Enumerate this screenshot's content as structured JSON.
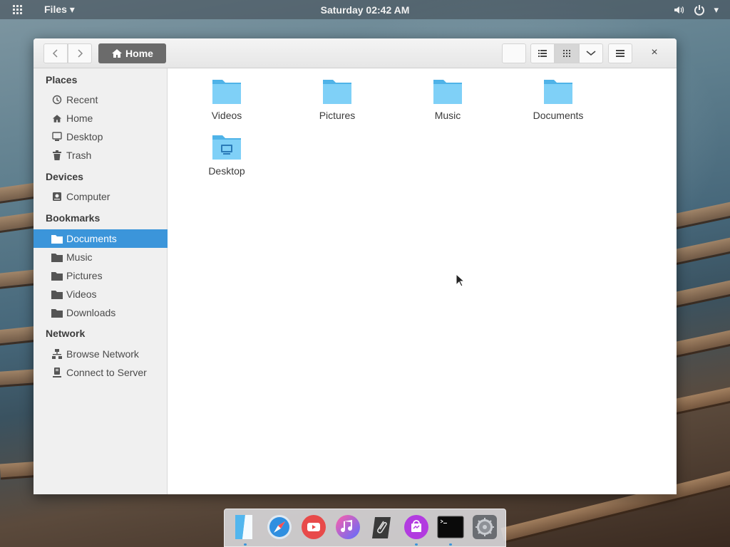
{
  "topbar": {
    "app_menu": "Files ▾",
    "clock": "Saturday 02:42 AM",
    "dropdown_arrow": "▾"
  },
  "window": {
    "path_label": "Home",
    "close_glyph": "×",
    "view_mode": "grid"
  },
  "sidebar": {
    "sections": [
      {
        "title": "Places",
        "items": [
          {
            "label": "Recent",
            "icon": "clock-icon"
          },
          {
            "label": "Home",
            "icon": "home-icon"
          },
          {
            "label": "Desktop",
            "icon": "desktop-icon"
          },
          {
            "label": "Trash",
            "icon": "trash-icon"
          }
        ]
      },
      {
        "title": "Devices",
        "items": [
          {
            "label": "Computer",
            "icon": "drive-icon"
          }
        ]
      },
      {
        "title": "Bookmarks",
        "items": [
          {
            "label": "Documents",
            "icon": "folder-icon",
            "active": true
          },
          {
            "label": "Music",
            "icon": "folder-icon"
          },
          {
            "label": "Pictures",
            "icon": "folder-icon"
          },
          {
            "label": "Videos",
            "icon": "folder-icon"
          },
          {
            "label": "Downloads",
            "icon": "folder-icon"
          }
        ]
      },
      {
        "title": "Network",
        "items": [
          {
            "label": "Browse Network",
            "icon": "network-icon"
          },
          {
            "label": "Connect to Server",
            "icon": "server-icon"
          }
        ]
      }
    ]
  },
  "files": [
    {
      "name": "Videos",
      "icon": "folder-icon"
    },
    {
      "name": "Pictures",
      "icon": "folder-icon"
    },
    {
      "name": "Music",
      "icon": "folder-icon"
    },
    {
      "name": "Documents",
      "icon": "folder-icon"
    },
    {
      "name": "Desktop",
      "icon": "desktop-folder-icon"
    }
  ],
  "dock": [
    {
      "app": "files",
      "icon": "files-icon",
      "running": true
    },
    {
      "app": "browser",
      "icon": "compass-icon",
      "running": false
    },
    {
      "app": "videos",
      "icon": "youtube-icon",
      "running": false
    },
    {
      "app": "music",
      "icon": "music-icon",
      "running": false
    },
    {
      "app": "notes",
      "icon": "paperclip-icon",
      "running": false
    },
    {
      "app": "appcenter",
      "icon": "shopping-bag-icon",
      "running": true
    },
    {
      "app": "terminal",
      "icon": "terminal-icon",
      "running": true
    },
    {
      "app": "settings",
      "icon": "gear-icon",
      "running": false
    }
  ],
  "colors": {
    "selection": "#3b95da",
    "folder": "#6cc6f2",
    "path_button": "#6b6b6b"
  }
}
